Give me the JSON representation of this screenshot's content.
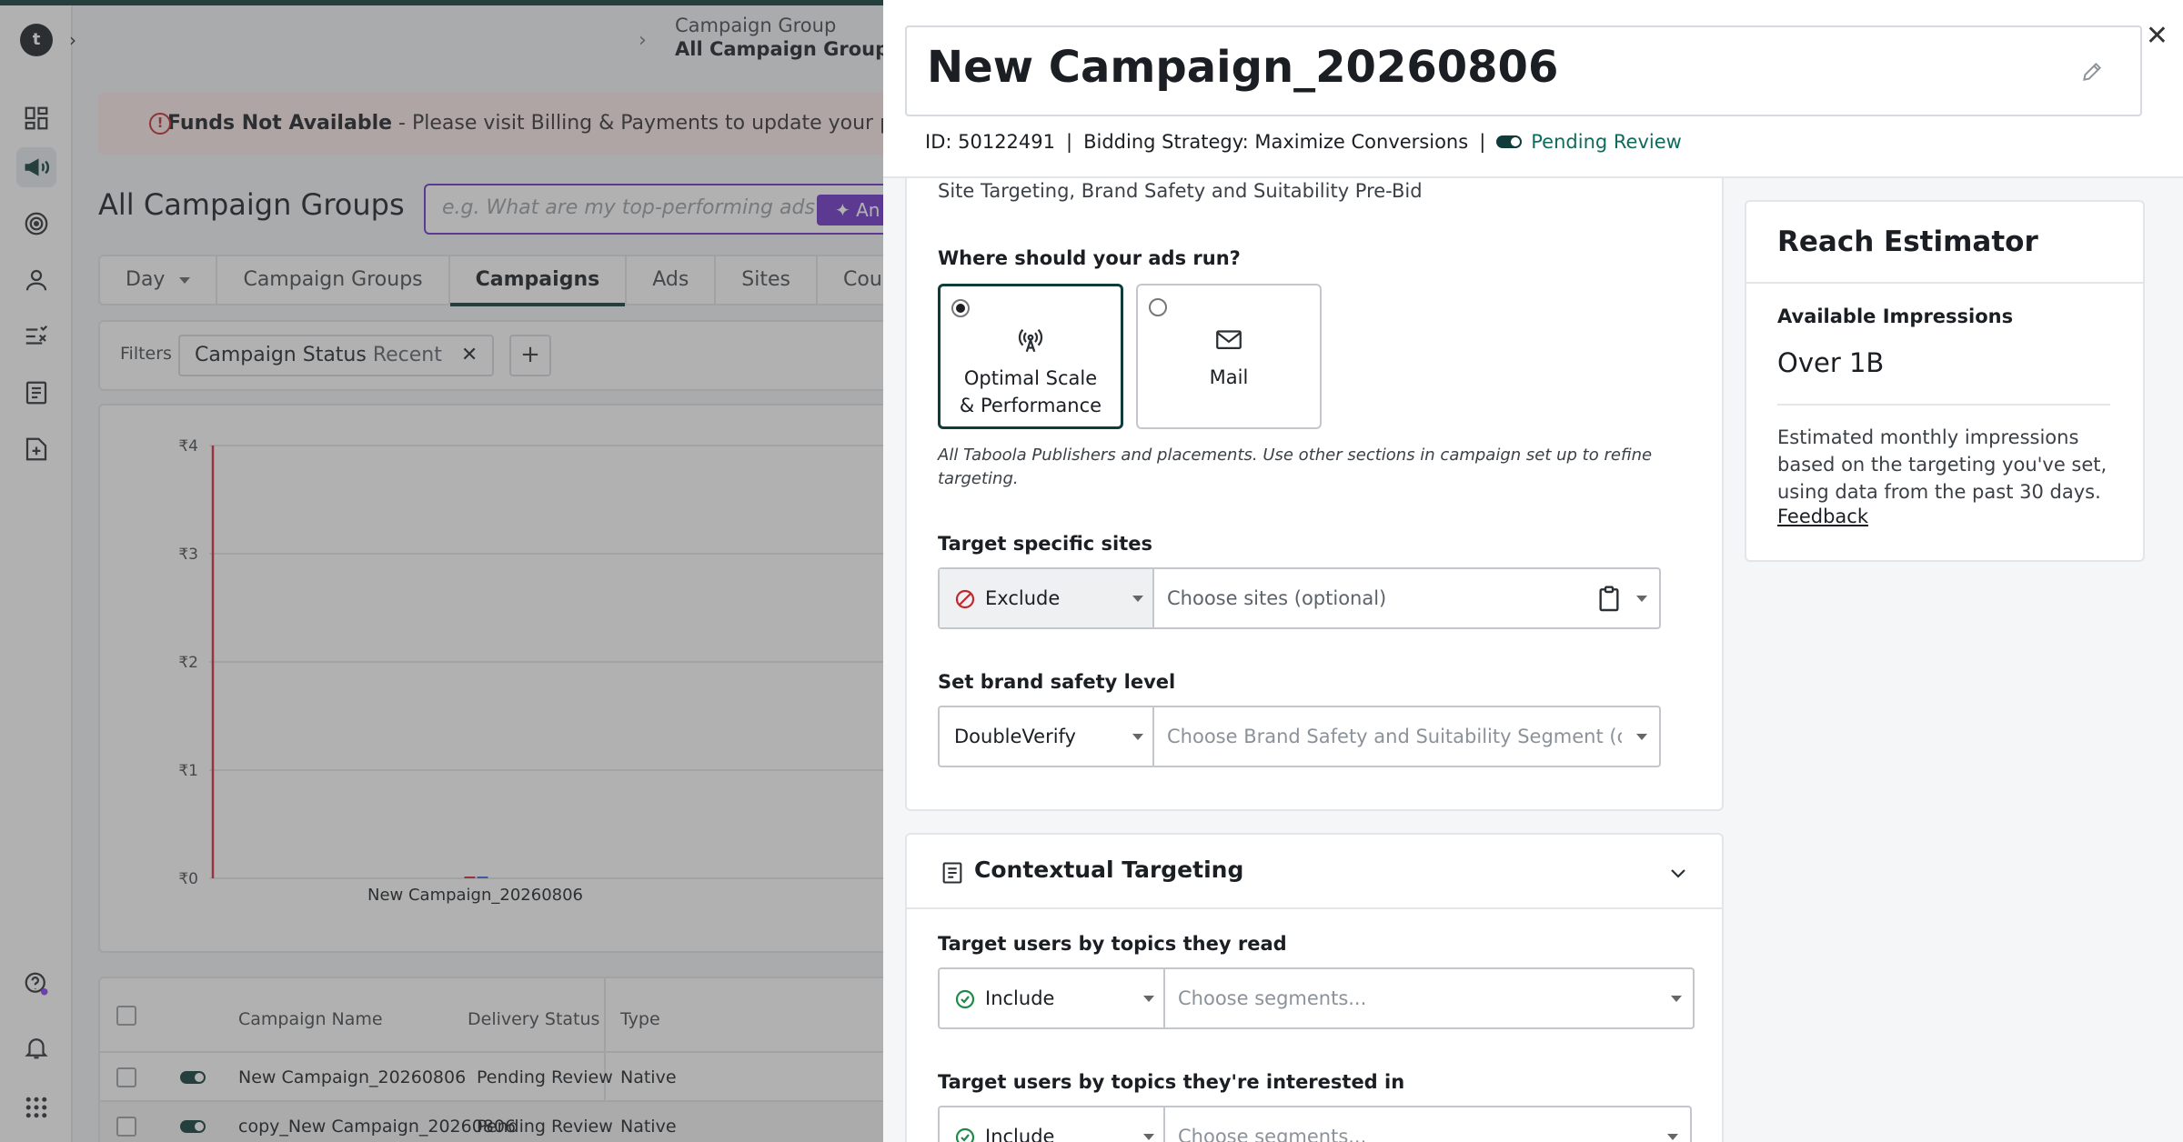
{
  "nav": {
    "logo_letter": "t",
    "expand_glyph": "›"
  },
  "background": {
    "breadcrumb": {
      "parent": "Campaign Group",
      "current": "All Campaign Groups ("
    },
    "alert": {
      "title": "Funds Not Available",
      "text": " - Please visit Billing & Payments to update your payment m"
    },
    "page_title": "All Campaign Groups",
    "search": {
      "placeholder": "e.g. What are my top-performing ads?",
      "button": "✦ An"
    },
    "tabs": [
      {
        "label": "Day",
        "active": false,
        "dropdown": true
      },
      {
        "label": "Campaign Groups",
        "active": false
      },
      {
        "label": "Campaigns",
        "active": true
      },
      {
        "label": "Ads",
        "active": false
      },
      {
        "label": "Sites",
        "active": false
      },
      {
        "label": "Coun",
        "active": false
      }
    ],
    "filters": {
      "label": "Filters",
      "chip_key": "Campaign Status",
      "chip_value": "Recent"
    },
    "table": {
      "headers": [
        "Campaign Name",
        "Delivery Status",
        "Type"
      ],
      "rows": [
        {
          "name": "New Campaign_20260806",
          "status": "Pending Review",
          "type": "Native"
        },
        {
          "name": "copy_New Campaign_20260806",
          "status": "Pending Review",
          "type": "Native"
        }
      ]
    }
  },
  "chart_data": {
    "type": "bar",
    "categories": [
      "New Campaign_20260806"
    ],
    "series": [
      {
        "values": [
          0
        ]
      },
      {
        "values": [
          0
        ]
      }
    ],
    "ytick_labels": [
      "₹0",
      "₹1",
      "₹2",
      "₹3",
      "₹4"
    ],
    "ylim": [
      0,
      4
    ],
    "grid": true,
    "colors": [
      "#d7263d",
      "#3b6fd8"
    ]
  },
  "panel": {
    "title": "New Campaign_20260806",
    "id_text": "ID: 50122491",
    "bidding_text": "Bidding Strategy: Maximize Conversions",
    "separator": "|",
    "status": "Pending Review",
    "site_section": {
      "subtitle": "Site Targeting, Brand Safety and Suitability Pre-Bid",
      "where_label": "Where should your ads run?",
      "options": [
        {
          "label": "Optimal Scale & Performance",
          "selected": true,
          "icon": "antenna-icon"
        },
        {
          "label": "Mail",
          "selected": false,
          "icon": "mail-icon"
        }
      ],
      "note": "All Taboola Publishers and placements. Use other sections in campaign set up to refine targeting.",
      "sites_label": "Target specific sites",
      "sites_mode": "Exclude",
      "sites_placeholder": "Choose sites (optional)",
      "brand_label": "Set brand safety level",
      "brand_provider": "DoubleVerify",
      "brand_placeholder": "Choose Brand Safety and Suitability Segment (o..."
    },
    "contextual": {
      "title": "Contextual Targeting",
      "read_label": "Target users by topics they read",
      "read_mode": "Include",
      "read_placeholder": "Choose segments...",
      "interest_label": "Target users by topics they're interested in",
      "interest_mode": "Include",
      "interest_placeholder": "Choose segments..."
    },
    "reach": {
      "title": "Reach Estimator",
      "impressions_label": "Available Impressions",
      "impressions_value": "Over 1B",
      "description": "Estimated monthly impressions based on the targeting you've set, using data from the past 30 days.",
      "feedback": "Feedback"
    }
  }
}
